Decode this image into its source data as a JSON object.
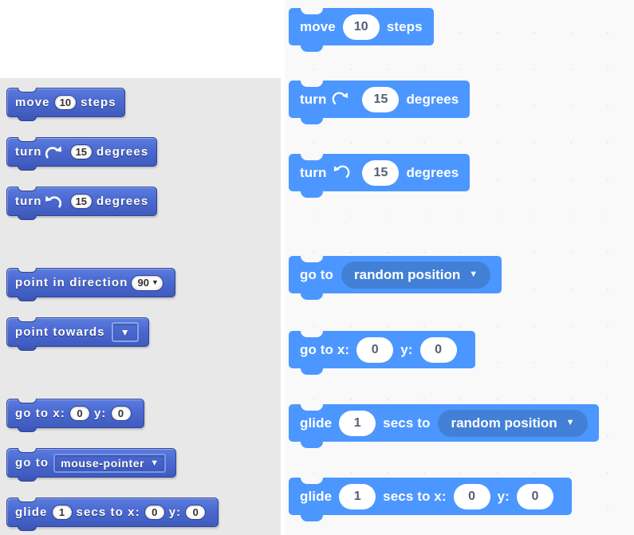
{
  "meta": {
    "subject": "Scratch Motion blocks: legacy (Scratch 2.0) vs current (Scratch 3.0) rendering",
    "left_panel_background": "#e8e8e8",
    "right_panel_background": "#f9f9f9",
    "left_block_color": "#4a68cf",
    "right_block_color": "#4c97ff",
    "right_dropdown_color": "#4280d7"
  },
  "legacy_palette": {
    "style_name": "scratch-2-motion-palette",
    "blocks": [
      {
        "id": "move-steps",
        "parts": [
          {
            "kind": "label",
            "text": "move"
          },
          {
            "kind": "oval",
            "value": "10"
          },
          {
            "kind": "label",
            "text": "steps"
          }
        ]
      },
      {
        "id": "turn-clockwise-degrees",
        "parts": [
          {
            "kind": "label",
            "text": "turn"
          },
          {
            "kind": "icon",
            "name": "turn-clockwise-icon"
          },
          {
            "kind": "oval",
            "value": "15"
          },
          {
            "kind": "label",
            "text": "degrees"
          }
        ]
      },
      {
        "id": "turn-counterclockwise-degrees",
        "parts": [
          {
            "kind": "label",
            "text": "turn"
          },
          {
            "kind": "icon",
            "name": "turn-counterclockwise-icon"
          },
          {
            "kind": "oval",
            "value": "15"
          },
          {
            "kind": "label",
            "text": "degrees"
          }
        ]
      },
      {
        "id": "point-in-direction",
        "parts": [
          {
            "kind": "label",
            "text": "point in direction"
          },
          {
            "kind": "dropdown-oval",
            "value": "90"
          }
        ]
      },
      {
        "id": "point-towards",
        "parts": [
          {
            "kind": "label",
            "text": "point towards"
          },
          {
            "kind": "dropdown-empty",
            "value": ""
          }
        ]
      },
      {
        "id": "go-to-xy",
        "parts": [
          {
            "kind": "label",
            "text": "go to  x:"
          },
          {
            "kind": "oval",
            "value": "0"
          },
          {
            "kind": "label",
            "text": "y:"
          },
          {
            "kind": "oval",
            "value": "0"
          }
        ]
      },
      {
        "id": "go-to-target",
        "parts": [
          {
            "kind": "label",
            "text": "go to"
          },
          {
            "kind": "dropdown-box",
            "value": "mouse-pointer"
          }
        ]
      },
      {
        "id": "glide-secs-to-xy",
        "parts": [
          {
            "kind": "label",
            "text": "glide"
          },
          {
            "kind": "oval",
            "value": "1"
          },
          {
            "kind": "label",
            "text": "secs to  x:"
          },
          {
            "kind": "oval",
            "value": "0"
          },
          {
            "kind": "label",
            "text": "y:"
          },
          {
            "kind": "oval",
            "value": "0"
          }
        ]
      }
    ]
  },
  "modern_palette": {
    "style_name": "scratch-3-motion-palette",
    "blocks": [
      {
        "id": "move-steps",
        "parts": [
          {
            "kind": "label",
            "text": "move"
          },
          {
            "kind": "oval",
            "value": "10"
          },
          {
            "kind": "label",
            "text": "steps"
          }
        ]
      },
      {
        "id": "turn-clockwise-degrees",
        "parts": [
          {
            "kind": "label",
            "text": "turn"
          },
          {
            "kind": "icon",
            "name": "turn-clockwise-icon"
          },
          {
            "kind": "oval",
            "value": "15"
          },
          {
            "kind": "label",
            "text": "degrees"
          }
        ]
      },
      {
        "id": "turn-counterclockwise-degrees",
        "parts": [
          {
            "kind": "label",
            "text": "turn"
          },
          {
            "kind": "icon",
            "name": "turn-counterclockwise-icon"
          },
          {
            "kind": "oval",
            "value": "15"
          },
          {
            "kind": "label",
            "text": "degrees"
          }
        ]
      },
      {
        "id": "go-to-target",
        "parts": [
          {
            "kind": "label",
            "text": "go to"
          },
          {
            "kind": "dropdown",
            "value": "random position"
          }
        ]
      },
      {
        "id": "go-to-xy",
        "parts": [
          {
            "kind": "label",
            "text": "go to x:"
          },
          {
            "kind": "oval",
            "value": "0"
          },
          {
            "kind": "label",
            "text": "y:"
          },
          {
            "kind": "oval",
            "value": "0"
          }
        ]
      },
      {
        "id": "glide-secs-to-target",
        "parts": [
          {
            "kind": "label",
            "text": "glide"
          },
          {
            "kind": "oval",
            "value": "1"
          },
          {
            "kind": "label",
            "text": "secs to"
          },
          {
            "kind": "dropdown",
            "value": "random position"
          }
        ]
      },
      {
        "id": "glide-secs-to-xy",
        "parts": [
          {
            "kind": "label",
            "text": "glide"
          },
          {
            "kind": "oval",
            "value": "1"
          },
          {
            "kind": "label",
            "text": "secs to x:"
          },
          {
            "kind": "oval",
            "value": "0"
          },
          {
            "kind": "label",
            "text": "y:"
          },
          {
            "kind": "oval",
            "value": "0"
          }
        ]
      }
    ]
  }
}
